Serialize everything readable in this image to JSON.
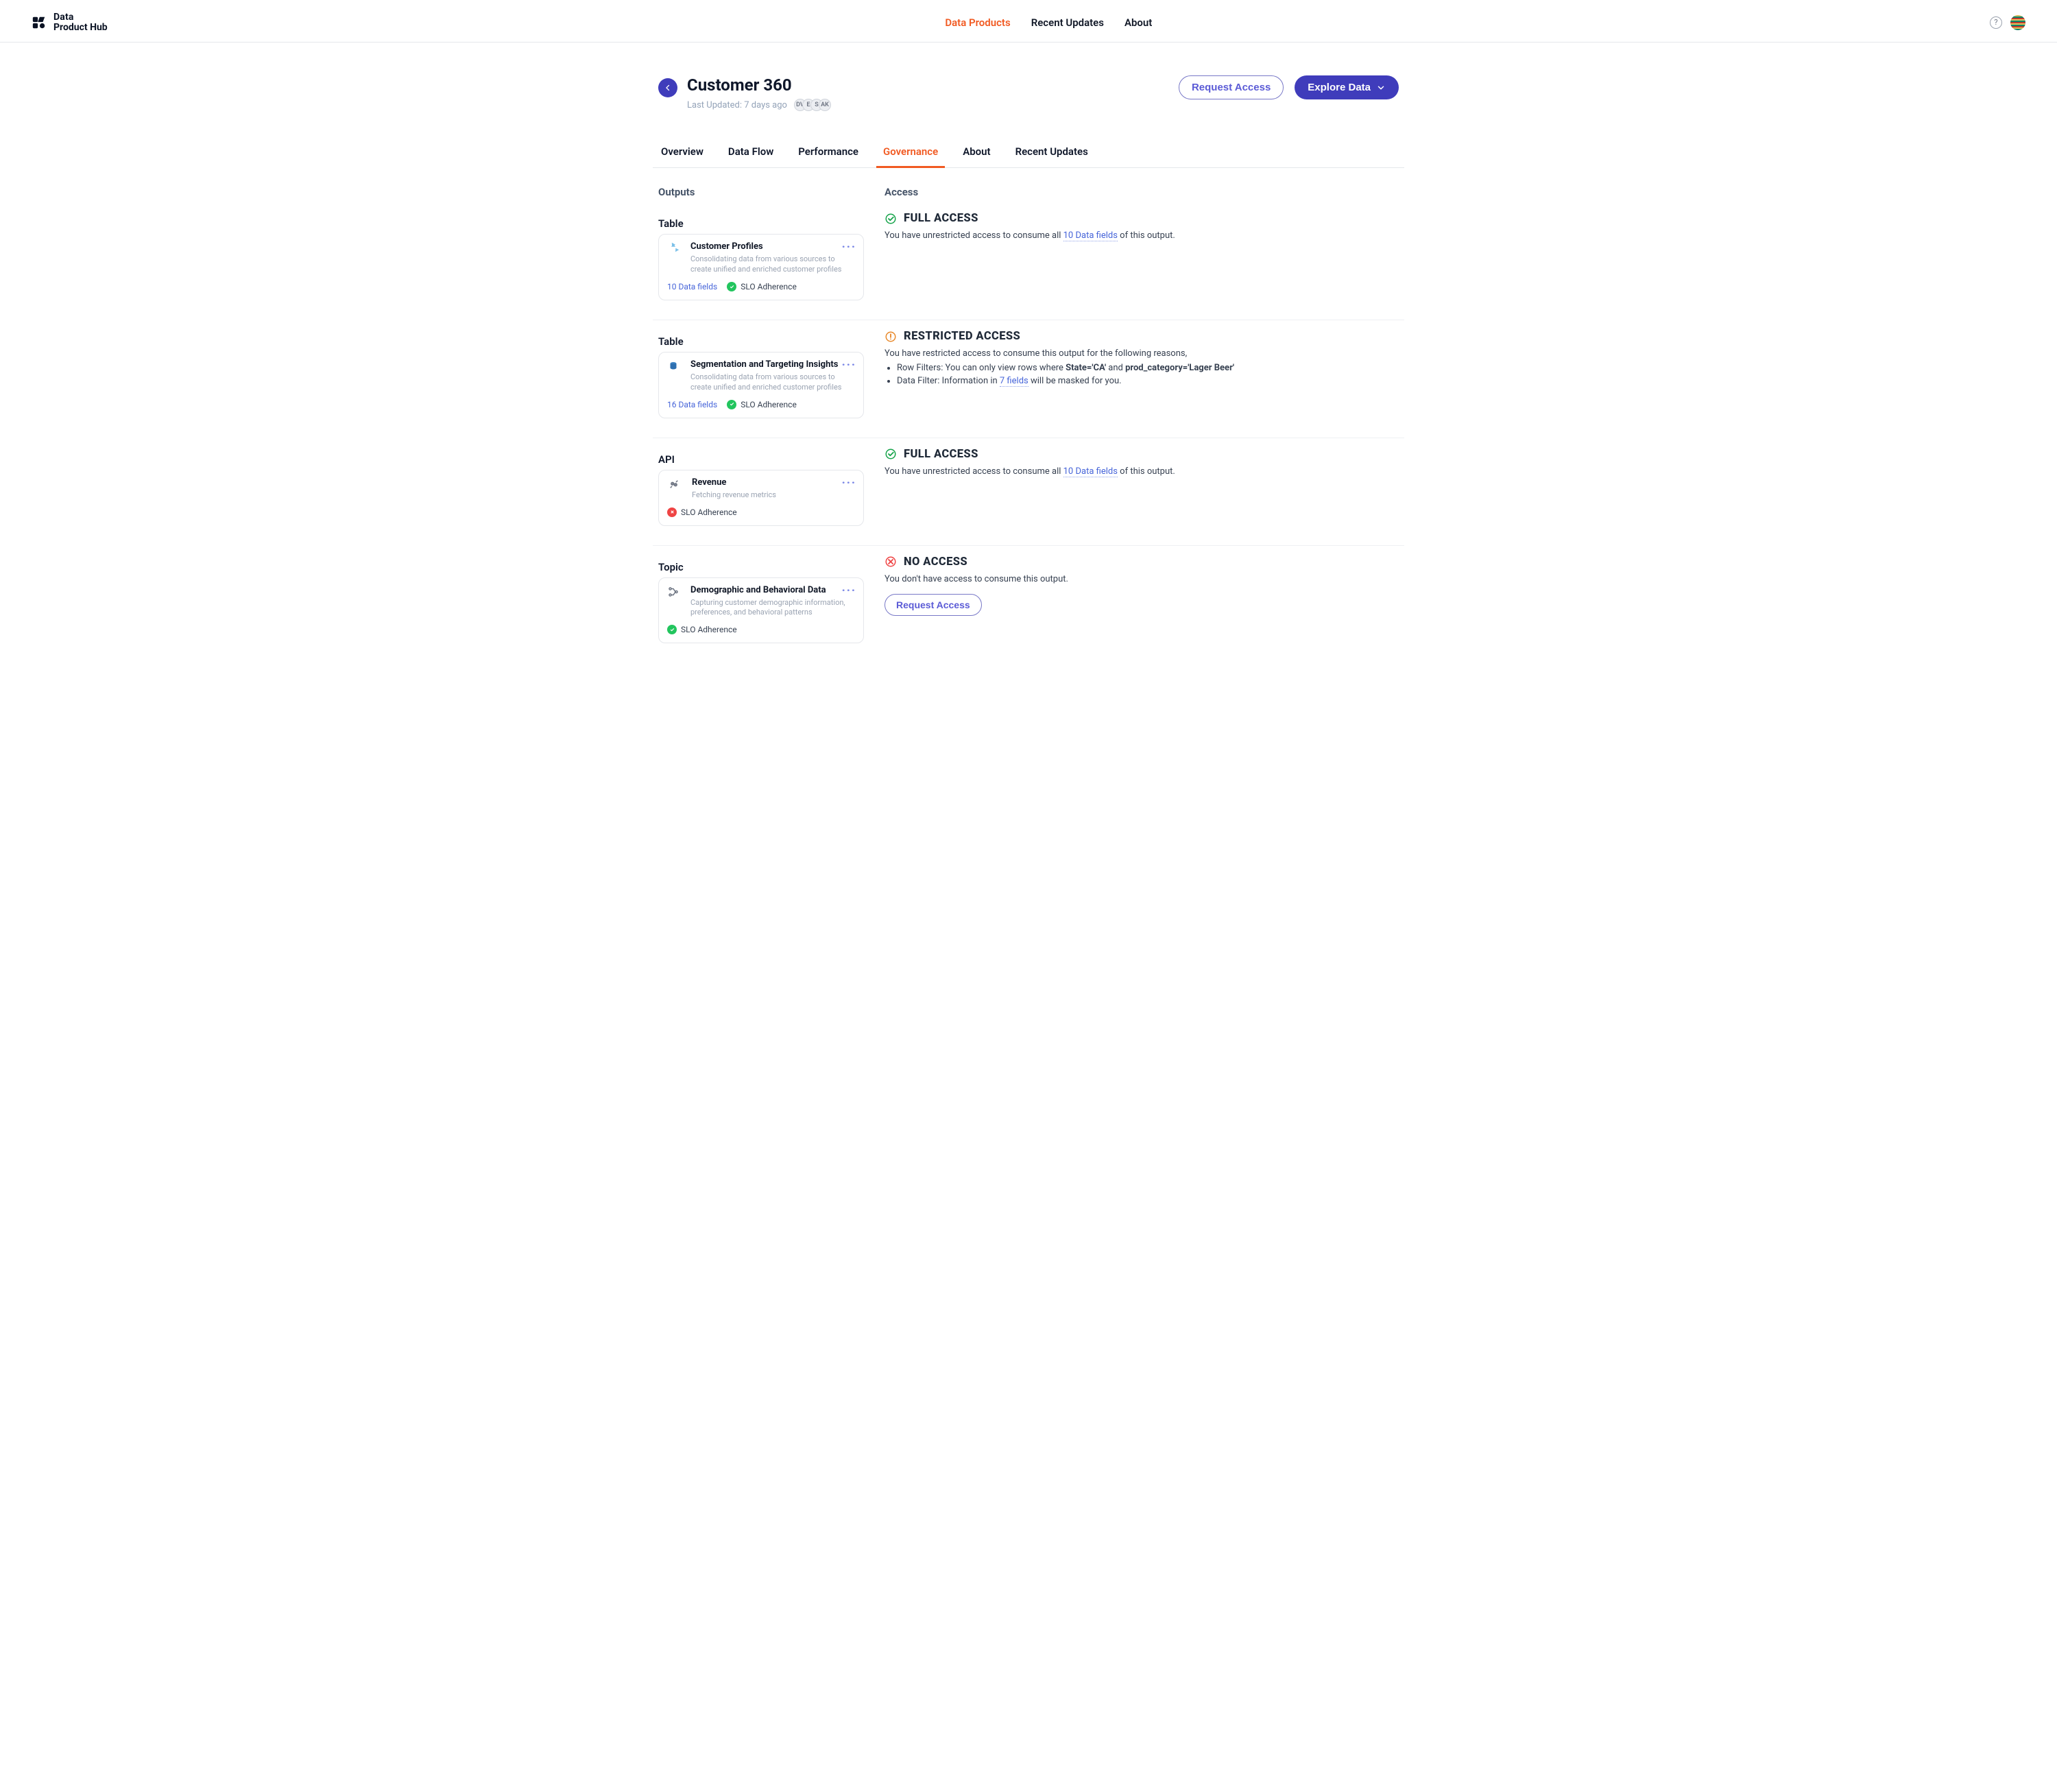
{
  "brand": {
    "line1": "Data",
    "line2": "Product Hub"
  },
  "nav": {
    "items": [
      "Data Products",
      "Recent Updates",
      "About"
    ],
    "activeIndex": 0
  },
  "header": {
    "title": "Customer 360",
    "updated_label": "Last Updated: 7 days ago",
    "avatars": [
      "DV",
      "E",
      "S",
      "AK"
    ],
    "request_access_label": "Request Access",
    "explore_label": "Explore Data"
  },
  "tabs": {
    "items": [
      "Overview",
      "Data Flow",
      "Performance",
      "Governance",
      "About",
      "Recent Updates"
    ],
    "activeIndex": 3
  },
  "section": {
    "outputs_title": "Outputs",
    "access_title": "Access"
  },
  "rows": [
    {
      "group": "Table",
      "card": {
        "icon": "fan",
        "title": "Customer Profiles",
        "desc": "Consolidating data from various sources to create unified and enriched customer profiles",
        "fields_label": "10 Data fields",
        "slo_label": "SLO Adherence",
        "slo_status": "green"
      },
      "access": {
        "type": "full",
        "title": "FULL ACCESS",
        "desc_before": "You have unrestricted access to consume all ",
        "desc_link": "10 Data fields",
        "desc_after": " of this output."
      }
    },
    {
      "group": "Table",
      "card": {
        "icon": "beetle",
        "title": "Segmentation and Targeting Insights",
        "desc": "Consolidating data from various sources to create unified and enriched customer profiles",
        "fields_label": "16 Data fields",
        "slo_label": "SLO Adherence",
        "slo_status": "green"
      },
      "access": {
        "type": "restricted",
        "title": "RESTRICTED ACCESS",
        "desc": "You have restricted access to consume this output for the following reasons,",
        "bullets": [
          {
            "prefix": "Row Filters: You can only view rows where ",
            "bold1": "State='CA'",
            "mid": " and ",
            "bold2": "prod_category='Lager Beer'"
          },
          {
            "prefix": "Data Filter: Information in ",
            "link": "7 fields",
            "suffix": " will be masked for you."
          }
        ]
      }
    },
    {
      "group": "API",
      "card": {
        "icon": "plug",
        "title": "Revenue",
        "desc": "Fetching revenue metrics",
        "fields_label": "",
        "slo_label": "SLO Adherence",
        "slo_status": "red"
      },
      "access": {
        "type": "full",
        "title": "FULL ACCESS",
        "desc_before": "You have unrestricted access to consume all ",
        "desc_link": "10 Data fields",
        "desc_after": " of this output."
      }
    },
    {
      "group": "Topic",
      "card": {
        "icon": "graph",
        "title": "Demographic and Behavioral Data",
        "desc": "Capturing customer demographic information, preferences, and behavioral patterns",
        "fields_label": "",
        "slo_label": "SLO Adherence",
        "slo_status": "green"
      },
      "access": {
        "type": "none",
        "title": "NO ACCESS",
        "desc": "You don't have access to consume this output.",
        "cta": "Request Access"
      }
    }
  ]
}
